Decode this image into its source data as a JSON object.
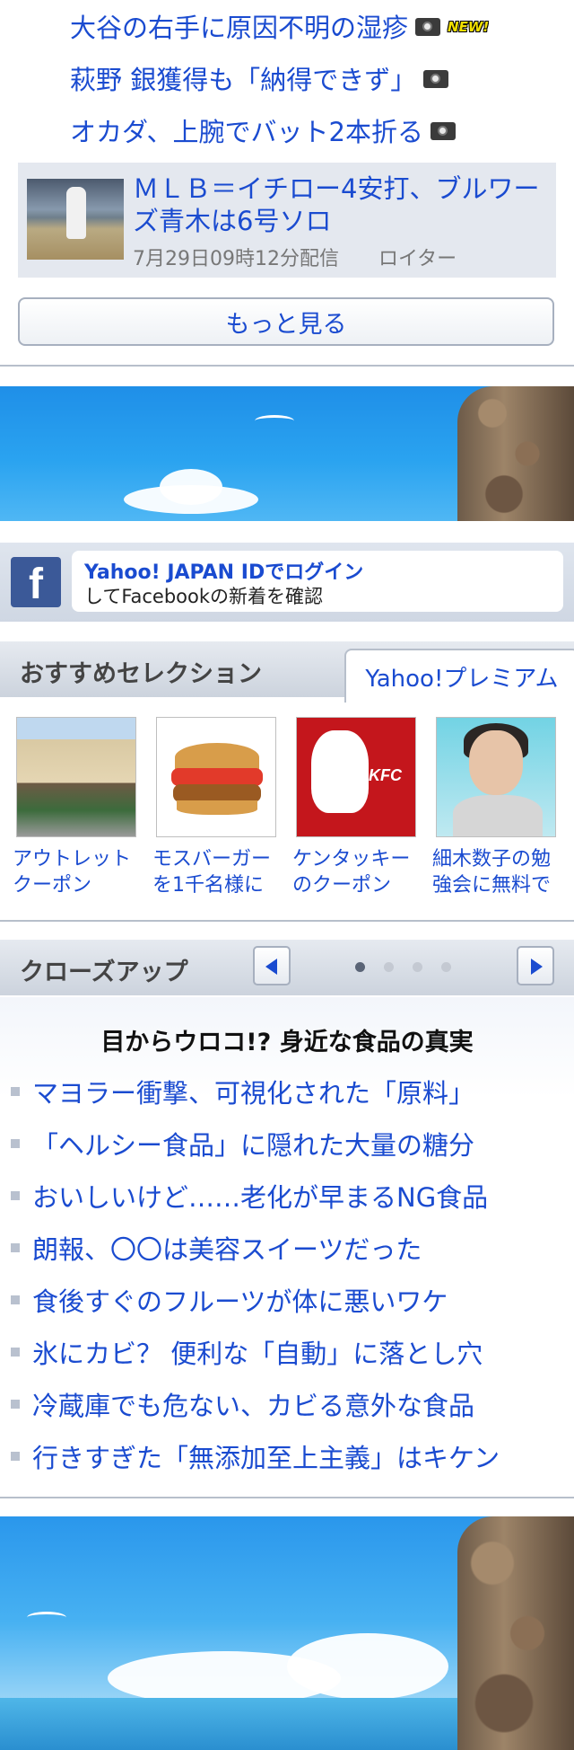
{
  "news": {
    "headlines": [
      {
        "text": "大谷の右手に原因不明の湿疹",
        "new_badge": "NEW!"
      },
      {
        "text": "萩野 銀獲得も「納得できず」"
      },
      {
        "text": "オカダ、上腕でバット2本折る"
      }
    ],
    "feature": {
      "title": "ＭＬＢ＝イチロー4安打、ブルワーズ青木は6号ソロ",
      "date": "7月29日09時12分配信",
      "source": "ロイター"
    },
    "more_label": "もっと見る"
  },
  "facebook": {
    "line1": "Yahoo! JAPAN IDでログイン",
    "line2": "してFacebookの新着を確認",
    "logo_letter": "f"
  },
  "selection": {
    "title": "おすすめセレクション",
    "tab_label": "Yahoo!プレミアム",
    "items": [
      {
        "caption_line1": "アウトレット",
        "caption_line2": "クーポン"
      },
      {
        "caption_line1": "モスバーガー",
        "caption_line2": "を1千名様に"
      },
      {
        "caption_line1": "ケンタッキー",
        "caption_line2": "のクーポン",
        "logo_text": "KFC"
      },
      {
        "caption_line1": "細木数子の勉",
        "caption_line2": "強会に無料で"
      }
    ]
  },
  "closeup": {
    "title": "クローズアップ",
    "pager_total": 4,
    "pager_current": 1,
    "heading": "目からウロコ!? 身近な食品の真実",
    "items": [
      "マヨラー衝撃、可視化された「原料」",
      "「ヘルシー食品」に隠れた大量の糖分",
      "おいしいけど……老化が早まるNG食品",
      "朗報、〇〇は美容スイーツだった",
      "食後すぐのフルーツが体に悪いワケ",
      "氷にカビ？ 便利な「自動」に落とし穴",
      "冷蔵庫でも危ない、カビる意外な食品",
      "行きすぎた「無添加至上主義」はキケン"
    ]
  },
  "colors": {
    "link": "#1a4bd0",
    "header_bg": "#ccd3dd",
    "facebook": "#3b5998",
    "sky": "#2aa3f0"
  }
}
